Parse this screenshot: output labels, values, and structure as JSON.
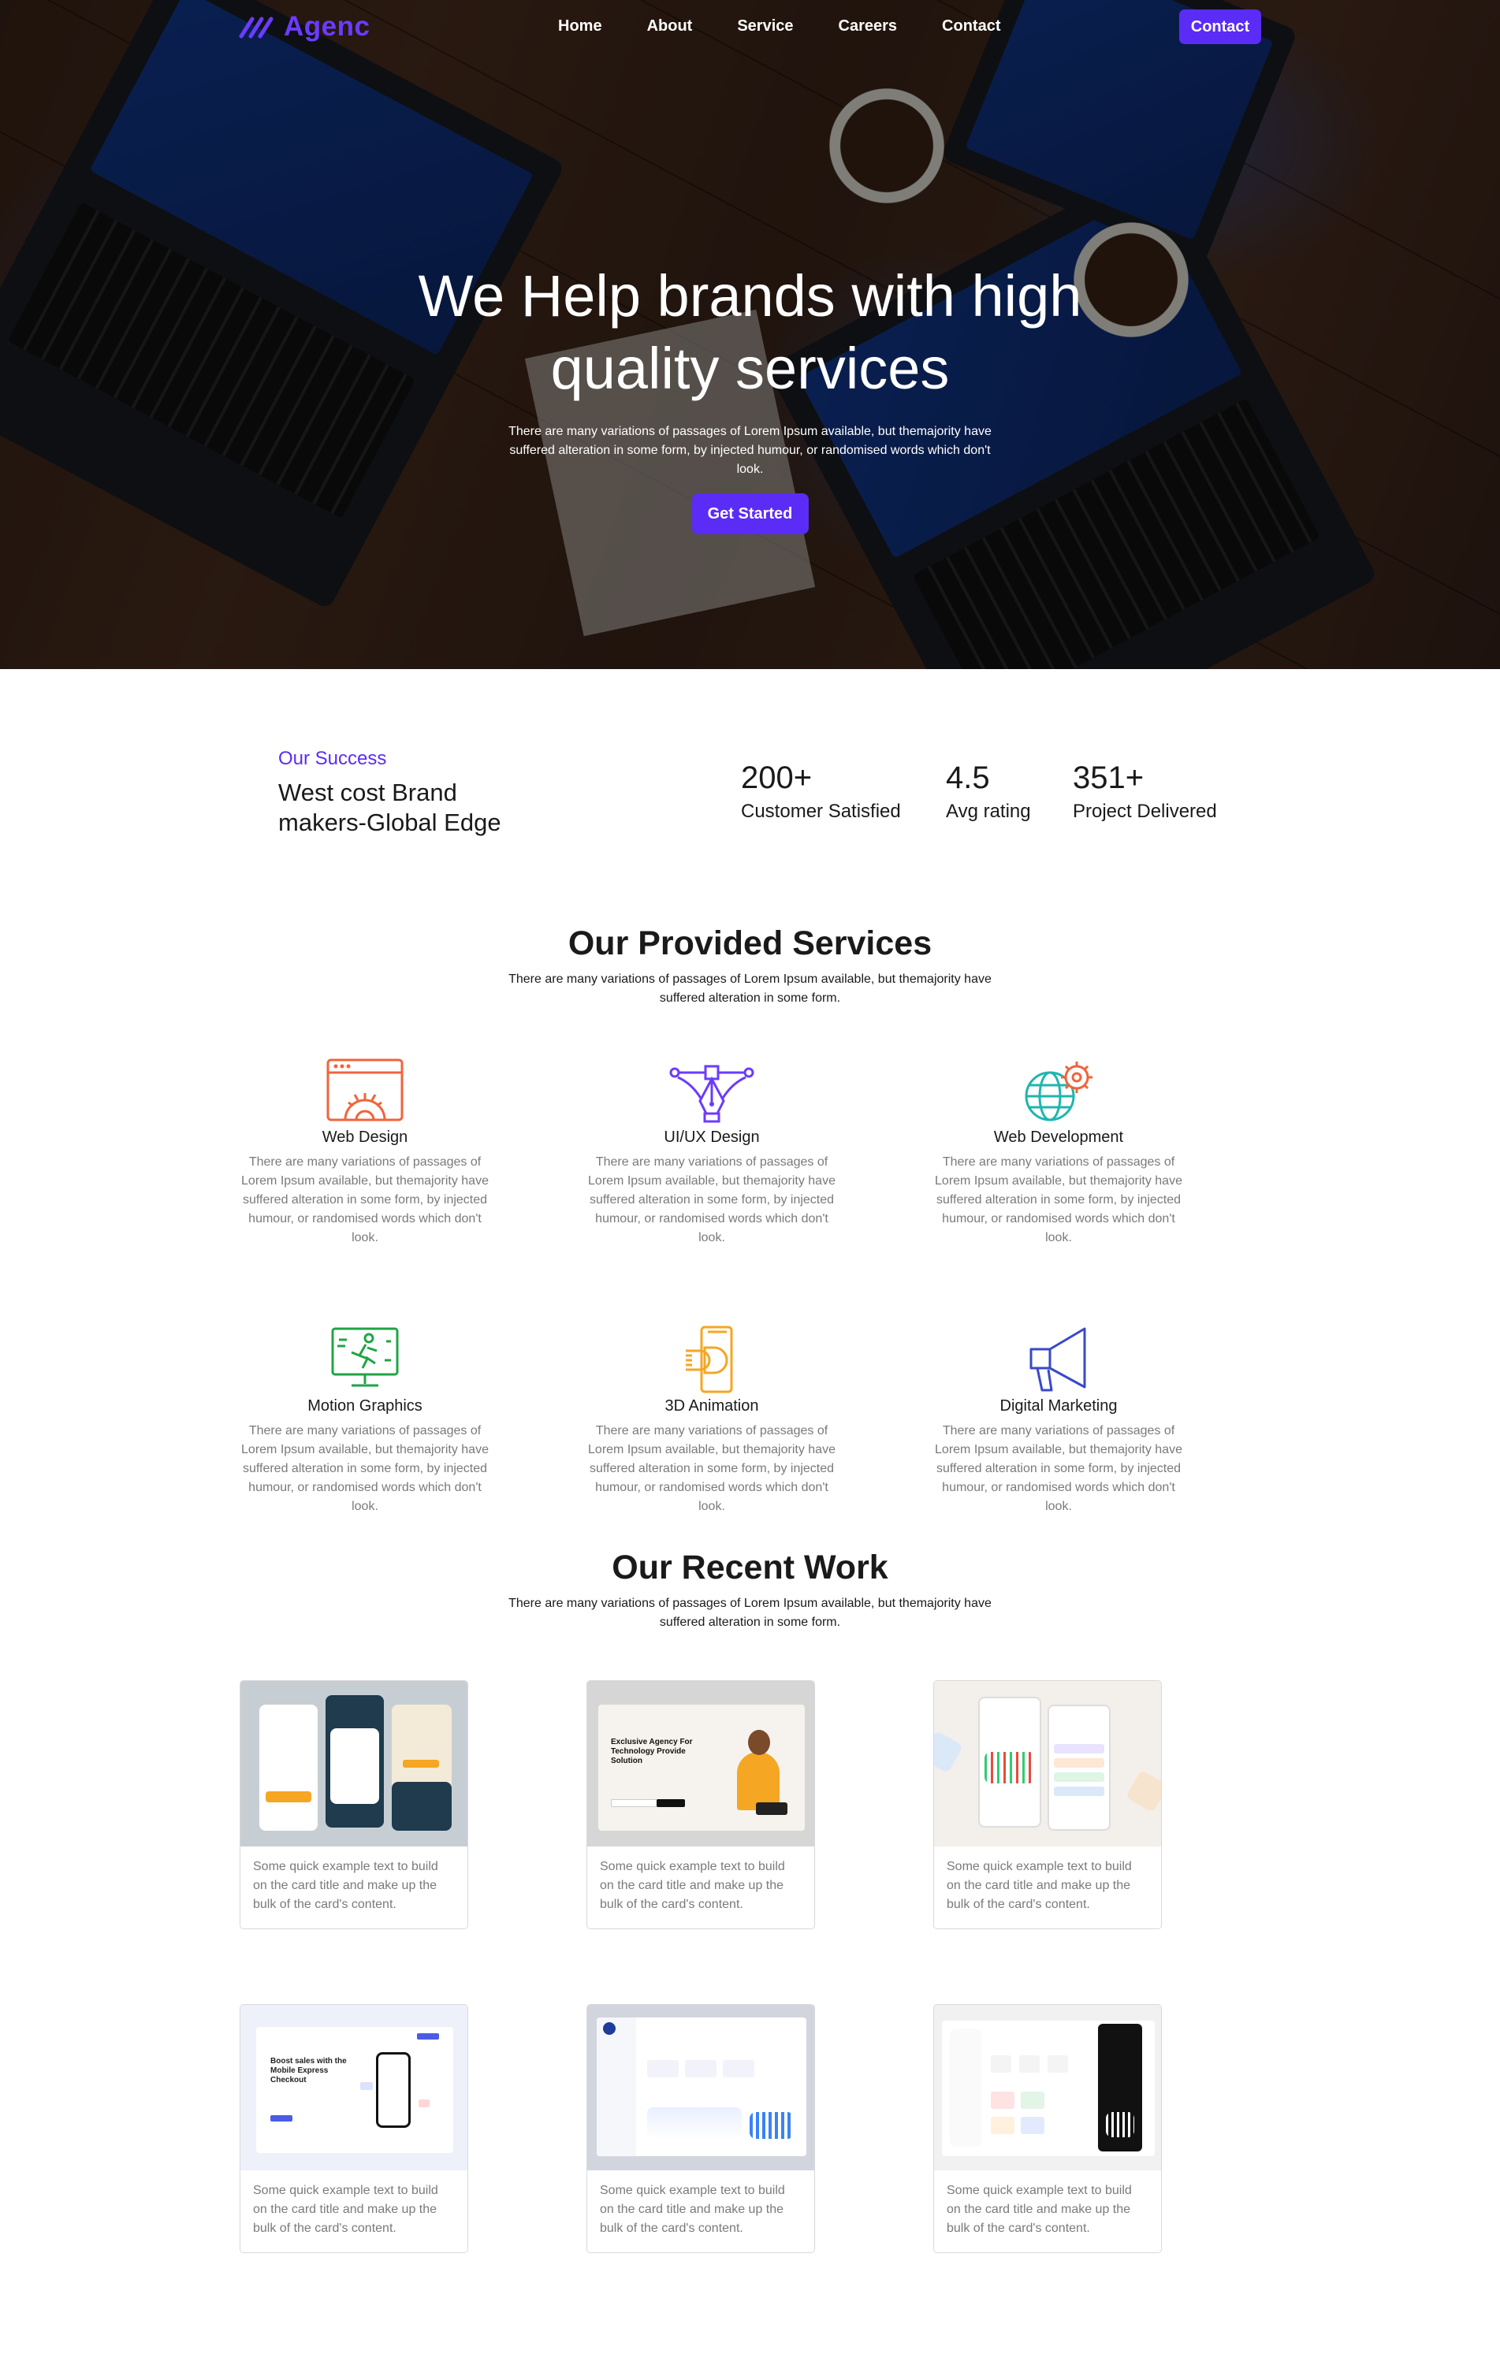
{
  "brand": {
    "name": "Agenc",
    "color": "#6b3bff",
    "accent": "#5b2cf5"
  },
  "nav": {
    "links": [
      "Home",
      "About",
      "Service",
      "Careers",
      "Contact"
    ],
    "cta": "Contact"
  },
  "hero": {
    "title": "We Help brands with high quality services",
    "subtitle": "There are many variations of passages of Lorem Ipsum available, but themajority have suffered alteration in some form, by injected humour, or randomised words which don't look.",
    "button": "Get Started"
  },
  "success": {
    "label": "Our Success",
    "title": "West cost Brand makers-Global Edge",
    "stats": [
      {
        "value": "200+",
        "label": "Customer Satisfied"
      },
      {
        "value": "4.5",
        "label": "Avg rating"
      },
      {
        "value": "351+",
        "label": "Project Delivered"
      }
    ]
  },
  "services": {
    "title": "Our Provided Services",
    "subtitle": "There are many variations of passages of Lorem Ipsum available, but themajority have suffered alteration in some form.",
    "items": [
      {
        "title": "Web Design",
        "icon": "web-design-icon",
        "color": "#f0643c",
        "desc": "There are many variations of passages of Lorem Ipsum available, but themajority have suffered alteration in some form, by injected humour, or randomised words which don't look."
      },
      {
        "title": "UI/UX Design",
        "icon": "pen-tool-icon",
        "color": "#6b3bff",
        "desc": "There are many variations of passages of Lorem Ipsum available, but themajority have suffered alteration in some form, by injected humour, or randomised words which don't look."
      },
      {
        "title": "Web Development",
        "icon": "globe-gear-icon",
        "color": "#1fb5b0",
        "desc": "There are many variations of passages of Lorem Ipsum available, but themajority have suffered alteration in some form, by injected humour, or randomised words which don't look."
      },
      {
        "title": "Motion Graphics",
        "icon": "monitor-runner-icon",
        "color": "#1fa544",
        "desc": "There are many variations of passages of Lorem Ipsum available, but themajority have suffered alteration in some form, by injected humour, or randomised words which don't look."
      },
      {
        "title": "3D Animation",
        "icon": "3d-box-icon",
        "color": "#f5a623",
        "desc": "There are many variations of passages of Lorem Ipsum available, but themajority have suffered alteration in some form, by injected humour, or randomised words which don't look."
      },
      {
        "title": "Digital Marketing",
        "icon": "megaphone-icon",
        "color": "#3949c8",
        "desc": "There are many variations of passages of Lorem Ipsum available, but themajority have suffered alteration in some form, by injected humour, or randomised words which don't look."
      }
    ]
  },
  "work": {
    "title": "Our Recent Work",
    "subtitle": "There are many variations of passages of Lorem Ipsum available, but themajority have suffered alteration in some form.",
    "cards": [
      {
        "text": "Some quick example text to build on the card title and make up the bulk of the card's content."
      },
      {
        "text": "Some quick example text to build on the card title and make up the bulk of the card's content.",
        "heading": "Exclusive Agency For Technology Provide Solution"
      },
      {
        "text": "Some quick example text to build on the card title and make up the bulk of the card's content."
      },
      {
        "text": "Some quick example text to build on the card title and make up the bulk of the card's content.",
        "heading": "Boost sales with the Mobile Express Checkout"
      },
      {
        "text": "Some quick example text to build on the card title and make up the bulk of the card's content."
      },
      {
        "text": "Some quick example text to build on the card title and make up the bulk of the card's content."
      }
    ]
  }
}
